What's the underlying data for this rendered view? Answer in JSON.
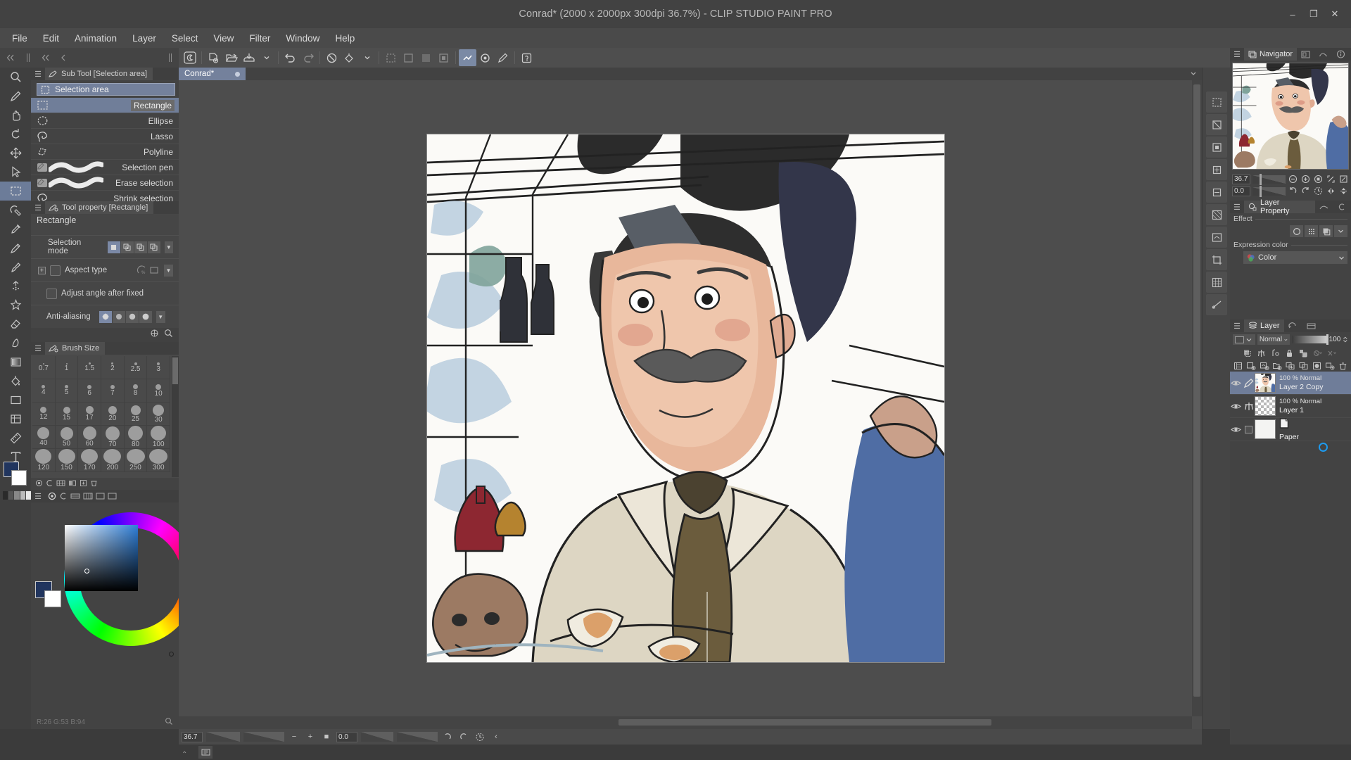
{
  "window": {
    "title": "Conrad* (2000 x 2000px 300dpi 36.7%)  -  CLIP STUDIO PAINT PRO",
    "minimize": "–",
    "maximize": "❐",
    "close": "✕"
  },
  "menu": {
    "items": [
      "File",
      "Edit",
      "Animation",
      "Layer",
      "Select",
      "View",
      "Filter",
      "Window",
      "Help"
    ]
  },
  "command_bar": {
    "icons": [
      "clip-studio-logo-icon",
      "new-document-icon",
      "open-file-icon",
      "save-icon",
      "save-dropdown-chevron-icon",
      "undo-icon",
      "redo-icon",
      "delete-icon",
      "fill-icon",
      "fill-dropdown-chevron-icon",
      "scale-rotate-icon",
      "select-all-icon",
      "deselect-icon",
      "invert-selection-icon",
      "expand-selection-icon",
      "selection-border-icon",
      "zoom-icon",
      "pen-icon",
      "help-icon"
    ]
  },
  "document_tabs": {
    "tabs": [
      {
        "label": "Conrad*",
        "modified_dot": true
      }
    ]
  },
  "tools": {
    "items": [
      "magnifier-tool",
      "pen-tool",
      "hand-tool",
      "rotate-tool",
      "move-layer-tool",
      "operation-tool",
      "marquee-tool",
      "auto-select-tool",
      "eyedropper-tool",
      "pencil-tool",
      "brush-tool",
      "airbrush-tool",
      "decoration-tool",
      "eraser-tool",
      "blend-tool",
      "gradient-tool",
      "fill-tool",
      "figure-tool",
      "frame-border-tool",
      "ruler-tool",
      "text-tool",
      "balloon-tool"
    ]
  },
  "sub_tool_panel": {
    "tab_label": "Sub Tool [Selection area]",
    "group_label": "Selection area",
    "items": [
      {
        "label": "Rectangle",
        "icon": "rectangle-marquee-icon",
        "selected": true
      },
      {
        "label": "Ellipse",
        "icon": "ellipse-marquee-icon",
        "selected": false
      },
      {
        "label": "Lasso",
        "icon": "lasso-icon",
        "selected": false
      },
      {
        "label": "Polyline",
        "icon": "polyline-icon",
        "selected": false
      },
      {
        "label": "Selection pen",
        "icon": "selection-pen-icon",
        "selected": false
      },
      {
        "label": "Erase selection",
        "icon": "erase-selection-icon",
        "selected": false
      },
      {
        "label": "Shrink selection",
        "icon": "shrink-selection-icon",
        "selected": false
      }
    ]
  },
  "tool_property": {
    "tab_label": "Tool property [Rectangle]",
    "tool_name": "Rectangle",
    "selection_mode": {
      "label": "Selection mode",
      "options": [
        "new-selection",
        "add-selection",
        "subtract-selection",
        "intersect-selection"
      ],
      "selected_index": 0
    },
    "aspect_type": {
      "label": "Aspect type"
    },
    "adjust_angle": {
      "label": "Adjust angle after fixed",
      "checked": false
    },
    "anti_aliasing": {
      "label": "Anti-aliasing",
      "options": [
        "none",
        "weak",
        "medium",
        "strong"
      ],
      "selected_index": 0
    }
  },
  "brush_size": {
    "tab_label": "Brush Size",
    "rows": [
      [
        "0.7",
        "1",
        "1.5",
        "2",
        "2.5",
        "3"
      ],
      [
        "4",
        "5",
        "6",
        "7",
        "8",
        "10"
      ],
      [
        "12",
        "15",
        "17",
        "20",
        "25",
        "30"
      ],
      [
        "40",
        "50",
        "60",
        "70",
        "80",
        "100"
      ],
      [
        "120",
        "150",
        "170",
        "200",
        "250",
        "300"
      ]
    ],
    "dot_sizes": [
      [
        2,
        2,
        3,
        3,
        4,
        4
      ],
      [
        5,
        5,
        6,
        6,
        7,
        8
      ],
      [
        9,
        10,
        11,
        12,
        14,
        16
      ],
      [
        17,
        18,
        19,
        20,
        21,
        22
      ],
      [
        23,
        24,
        24,
        25,
        26,
        26
      ]
    ]
  },
  "color_panel": {
    "foreground": "#21355e",
    "background": "#ffffff",
    "wheel_label": "color-wheel"
  },
  "navigator": {
    "tabs": [
      "Navigator",
      "item-bank-icon",
      "sub-view-icon",
      "information-icon"
    ],
    "active_tab": "Navigator",
    "zoom_value": "36.7",
    "rotation_value": "0.0",
    "buttons": [
      "zoom-out-icon",
      "zoom-in-icon",
      "fit-icon",
      "fit-to-screen-icon",
      "fullscreen-icon",
      "rotate-left-icon",
      "rotate-right-icon",
      "reset-rotation-icon",
      "flip-horizontal-icon",
      "flip-vertical-icon"
    ]
  },
  "layer_property": {
    "tabs": [
      "Layer Property",
      "animation-cels-icon",
      "sub-tool-detail-icon"
    ],
    "active_tab": "Layer Property",
    "effect": {
      "label": "Effect",
      "options": [
        "border-effect-icon",
        "tone-effect-icon",
        "layer-color-icon"
      ]
    },
    "expression_color": {
      "label": "Expression color",
      "value": "Color"
    }
  },
  "layer_panel": {
    "tabs": [
      "Layer",
      "animation-timeline-icon",
      "layer-search-icon"
    ],
    "active_tab": "Layer",
    "blend_mode": "Normal",
    "opacity": "100",
    "toolbar_icons": [
      "clipping-icon",
      "mask-icon",
      "ruler-icon",
      "lock-icon",
      "lock-transparency-icon",
      "layer-mask-off-icon",
      "ruler-off-icon"
    ],
    "bottom_icons": [
      "palette-list-icon",
      "new-raster-layer-icon",
      "new-vector-layer-icon",
      "new-folder-icon",
      "transfer-down-icon",
      "duplicate-layer-icon",
      "layer-mask-icon",
      "merge-down-icon",
      "delete-layer-icon"
    ],
    "layers": [
      {
        "name": "Layer 2 Copy",
        "blend": "100 % Normal",
        "visible": true,
        "selected": true,
        "kind": "raster-draft-icon",
        "thumb": "artwork"
      },
      {
        "name": "Layer 1",
        "blend": "100 % Normal",
        "visible": true,
        "selected": false,
        "kind": "ruler-icon",
        "thumb": "transparent"
      },
      {
        "name": "Paper",
        "blend": "",
        "visible": true,
        "selected": false,
        "kind": "none",
        "thumb": "white"
      }
    ]
  },
  "status_bar": {
    "zoom_value": "36.7",
    "rotation_value": "0.0",
    "controls": [
      "zoom-out-icon",
      "zoom-in-icon",
      "fit-icon",
      "rotate-left-icon",
      "rotate-right-icon",
      "reset-rotation-icon",
      "collapse-icon"
    ]
  },
  "bottom_bar": {
    "icons": [
      "timeline-panel-icon"
    ],
    "caret": "⌃"
  },
  "canvas": {
    "title": "Conrad artwork - cartoon portrait of a man in shirt and tie",
    "background": "#fbfaf7"
  }
}
